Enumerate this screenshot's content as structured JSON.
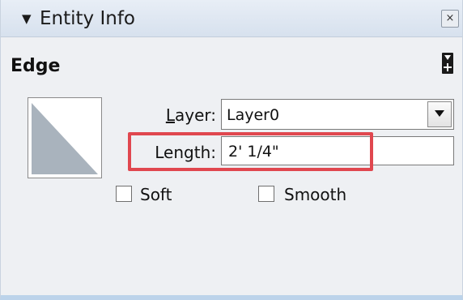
{
  "window": {
    "title": "Entity Info",
    "collapse_glyph": "▼",
    "close_glyph": "×"
  },
  "header": {
    "entity_type": "Edge",
    "expand_icon": "details-toggle-icon"
  },
  "fields": {
    "layer_label_mnemonic": "L",
    "layer_label_rest": "ayer:",
    "layer_value": "Layer0",
    "length_label": "Length:",
    "length_value": "2' 1/4\""
  },
  "checkboxes": {
    "soft_label": "Soft",
    "soft_checked": false,
    "smooth_label": "Smooth",
    "smooth_checked": false
  },
  "colors": {
    "highlight": "#e0474f",
    "swatch_fill": "#a9b3bd",
    "title_bar": "#d7e1ee"
  }
}
